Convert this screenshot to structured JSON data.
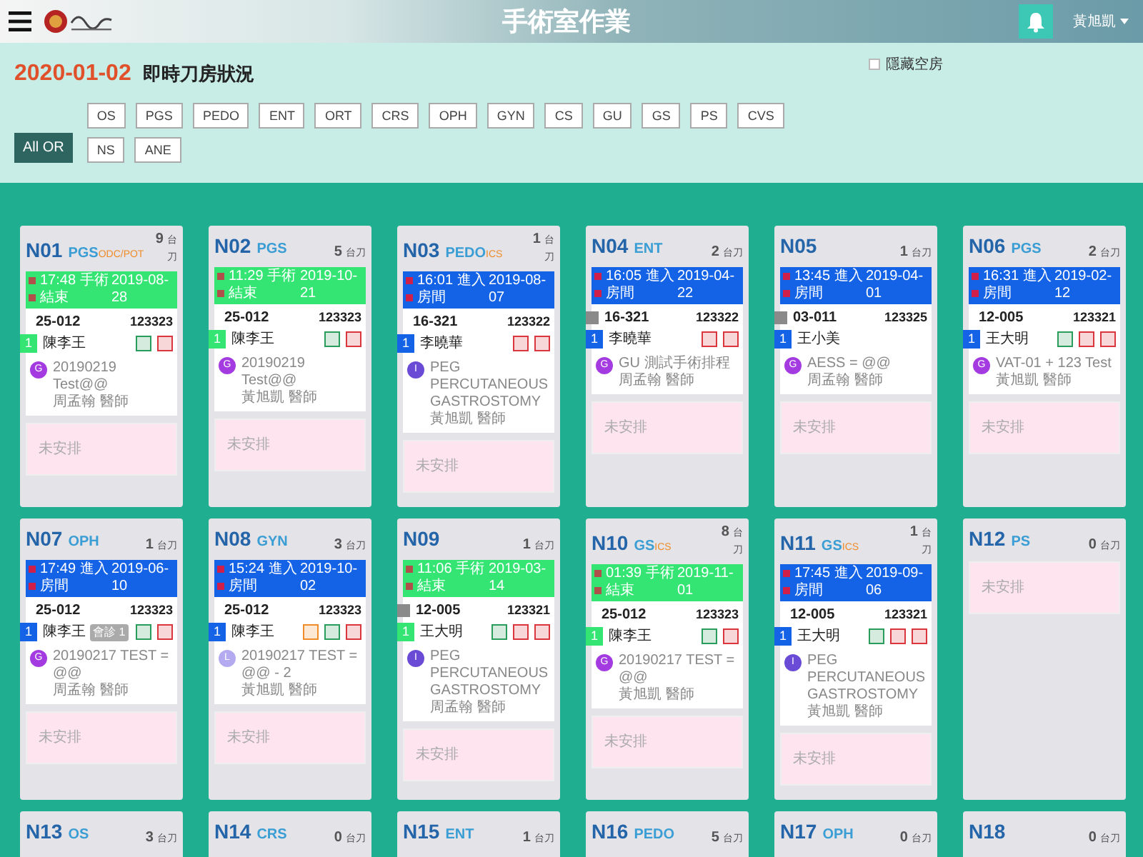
{
  "header": {
    "title": "手術室作業",
    "user": "黃旭凱"
  },
  "summary": {
    "date": "2020-01-02",
    "title": "即時刀房狀況",
    "hide_empty": {
      "label": "隱藏空房",
      "checked": false
    }
  },
  "all_or": {
    "label": "All OR",
    "selected": true
  },
  "filters": [
    {
      "label": "OS",
      "selected": false
    },
    {
      "label": "PGS",
      "selected": false
    },
    {
      "label": "PEDO",
      "selected": false
    },
    {
      "label": "ENT",
      "selected": false
    },
    {
      "label": "ORT",
      "selected": false
    },
    {
      "label": "CRS",
      "selected": false
    },
    {
      "label": "OPH",
      "selected": false
    },
    {
      "label": "GYN",
      "selected": false
    },
    {
      "label": "CS",
      "selected": false
    },
    {
      "label": "GU",
      "selected": false
    },
    {
      "label": "GS",
      "selected": false
    },
    {
      "label": "PS",
      "selected": false
    },
    {
      "label": "CVS",
      "selected": false
    },
    {
      "label": "NS",
      "selected": false
    },
    {
      "label": "ANE",
      "selected": false
    }
  ],
  "rooms": [
    {
      "room": "N01",
      "dept": "PGS",
      "tag": "ODC/POT",
      "count": "9",
      "unit": "台刀",
      "status": {
        "kind": "done",
        "text": "17:48 手術結束",
        "date": "2019-08-28"
      },
      "case": {
        "bed": "25-012",
        "id": "123323",
        "seq": "1",
        "marked": false,
        "name": "陳李王",
        "badges": [
          {
            "color": "#2a9d5c"
          },
          {
            "color": "#d9363e"
          }
        ],
        "proc": {
          "letter": "G",
          "color": "#a43be0",
          "text": "20190219 Test@@",
          "doctor": "周孟翰 醫師"
        }
      },
      "pending": "未安排"
    },
    {
      "room": "N02",
      "dept": "PGS",
      "count": "5",
      "unit": "台刀",
      "status": {
        "kind": "done",
        "text": "11:29 手術結束",
        "date": "2019-10-21"
      },
      "case": {
        "bed": "25-012",
        "id": "123323",
        "seq": "1",
        "marked": false,
        "name": "陳李王",
        "badges": [
          {
            "color": "#2a9d5c"
          },
          {
            "color": "#d9363e"
          }
        ],
        "proc": {
          "letter": "G",
          "color": "#a43be0",
          "text": "20190219 Test@@",
          "doctor": "黃旭凱 醫師"
        }
      },
      "pending": "未安排"
    },
    {
      "room": "N03",
      "dept": "PEDO",
      "tag": "ICS",
      "count": "1",
      "unit": "台刀",
      "status": {
        "kind": "in_room",
        "text": "16:01 進入房間",
        "date": "2019-08-07"
      },
      "case": {
        "bed": "16-321",
        "id": "123322",
        "seq": "1",
        "marked": false,
        "name": "李曉華",
        "badges": [
          {
            "color": "#d9363e"
          },
          {
            "color": "#d9363e"
          }
        ],
        "proc": {
          "letter": "I",
          "color": "#6a4bd6",
          "text": "PEG PERCUTANEOUS GASTROSTOMY",
          "doctor": "黃旭凱 醫師"
        }
      },
      "pending": "未安排"
    },
    {
      "room": "N04",
      "dept": "ENT",
      "count": "2",
      "unit": "台刀",
      "status": {
        "kind": "in_room",
        "text": "16:05 進入房間",
        "date": "2019-04-22"
      },
      "case": {
        "bed": "16-321",
        "id": "123322",
        "seq": "1",
        "marked": true,
        "name": "李曉華",
        "badges": [
          {
            "color": "#d9363e"
          },
          {
            "color": "#d9363e"
          }
        ],
        "proc": {
          "letter": "G",
          "color": "#a43be0",
          "text": "GU 測試手術排程",
          "doctor": "周孟翰 醫師"
        }
      },
      "pending": "未安排"
    },
    {
      "room": "N05",
      "count": "1",
      "unit": "台刀",
      "status": {
        "kind": "in_room",
        "text": "13:45 進入房間",
        "date": "2019-04-01"
      },
      "case": {
        "bed": "03-011",
        "id": "123325",
        "seq": "1",
        "marked": true,
        "name": "王小美",
        "proc": {
          "letter": "G",
          "color": "#a43be0",
          "text": "AESS = @@",
          "doctor": "周孟翰 醫師"
        }
      },
      "pending": "未安排"
    },
    {
      "room": "N06",
      "dept": "PGS",
      "count": "2",
      "unit": "台刀",
      "status": {
        "kind": "in_room",
        "text": "16:31 進入房間",
        "date": "2019-02-12"
      },
      "case": {
        "bed": "12-005",
        "id": "123321",
        "seq": "1",
        "marked": false,
        "name": "王大明",
        "badges": [
          {
            "color": "#2a9d5c"
          },
          {
            "color": "#d9363e"
          },
          {
            "color": "#d9363e"
          }
        ],
        "proc": {
          "letter": "G",
          "color": "#a43be0",
          "text": "VAT-01 + 123 Test",
          "doctor": "黃旭凱 醫師"
        }
      },
      "pending": "未安排"
    },
    {
      "room": "N07",
      "dept": "OPH",
      "count": "1",
      "unit": "台刀",
      "status": {
        "kind": "in_room",
        "text": "17:49 進入房間",
        "date": "2019-06-10"
      },
      "case": {
        "bed": "25-012",
        "id": "123323",
        "seq": "1",
        "marked": false,
        "name": "陳李王",
        "note": "會診 1",
        "badges": [
          {
            "color": "#2a9d5c"
          },
          {
            "color": "#d9363e"
          }
        ],
        "proc": {
          "letter": "G",
          "color": "#a43be0",
          "text": "20190217 TEST = @@",
          "doctor": "周孟翰 醫師"
        }
      },
      "pending": "未安排"
    },
    {
      "room": "N08",
      "dept": "GYN",
      "count": "3",
      "unit": "台刀",
      "status": {
        "kind": "in_room",
        "text": "15:24 進入房間",
        "date": "2019-10-02"
      },
      "case": {
        "bed": "25-012",
        "id": "123323",
        "seq": "1",
        "marked": false,
        "name": "陳李王",
        "badges": [
          {
            "color": "#f08c2a"
          },
          {
            "color": "#2a9d5c"
          },
          {
            "color": "#d9363e"
          }
        ],
        "proc": {
          "letter": "L",
          "color": "#b4aaf0",
          "text": "20190217 TEST = @@ - 2",
          "doctor": "黃旭凱 醫師"
        }
      },
      "pending": "未安排"
    },
    {
      "room": "N09",
      "count": "1",
      "unit": "台刀",
      "status": {
        "kind": "done",
        "text": "11:06 手術結束",
        "date": "2019-03-14"
      },
      "case": {
        "bed": "12-005",
        "id": "123321",
        "seq": "1",
        "marked": true,
        "name": "王大明",
        "badges": [
          {
            "color": "#2a9d5c"
          },
          {
            "color": "#d9363e"
          },
          {
            "color": "#d9363e"
          }
        ],
        "proc": {
          "letter": "I",
          "color": "#6a4bd6",
          "text": "PEG PERCUTANEOUS GASTROSTOMY",
          "doctor": "周孟翰 醫師"
        }
      },
      "pending": "未安排"
    },
    {
      "room": "N10",
      "dept": "GS",
      "tag": "ICS",
      "count": "8",
      "unit": "台刀",
      "status": {
        "kind": "done",
        "text": "01:39 手術結束",
        "date": "2019-11-01"
      },
      "case": {
        "bed": "25-012",
        "id": "123323",
        "seq": "1",
        "marked": false,
        "name": "陳李王",
        "badges": [
          {
            "color": "#2a9d5c"
          },
          {
            "color": "#d9363e"
          }
        ],
        "proc": {
          "letter": "G",
          "color": "#a43be0",
          "text": "20190217 TEST = @@",
          "doctor": "黃旭凱 醫師"
        }
      },
      "pending": "未安排"
    },
    {
      "room": "N11",
      "dept": "GS",
      "tag": "ICS",
      "count": "1",
      "unit": "台刀",
      "status": {
        "kind": "in_room",
        "text": "17:45 進入房間",
        "date": "2019-09-06"
      },
      "case": {
        "bed": "12-005",
        "id": "123321",
        "seq": "1",
        "marked": false,
        "name": "王大明",
        "badges": [
          {
            "color": "#2a9d5c"
          },
          {
            "color": "#d9363e"
          },
          {
            "color": "#d9363e"
          }
        ],
        "proc": {
          "letter": "I",
          "color": "#6a4bd6",
          "text": "PEG PERCUTANEOUS GASTROSTOMY",
          "doctor": "黃旭凱 醫師"
        }
      },
      "pending": "未安排"
    },
    {
      "room": "N12",
      "dept": "PS",
      "count": "0",
      "unit": "台刀",
      "pending": "未安排"
    },
    {
      "room": "N13",
      "dept": "OS",
      "count": "3",
      "unit": "台刀"
    },
    {
      "room": "N14",
      "dept": "CRS",
      "count": "0",
      "unit": "台刀"
    },
    {
      "room": "N15",
      "dept": "ENT",
      "count": "1",
      "unit": "台刀"
    },
    {
      "room": "N16",
      "dept": "PEDO",
      "count": "5",
      "unit": "台刀"
    },
    {
      "room": "N17",
      "dept": "OPH",
      "count": "0",
      "unit": "台刀"
    },
    {
      "room": "N18",
      "count": "0",
      "unit": "台刀"
    }
  ]
}
